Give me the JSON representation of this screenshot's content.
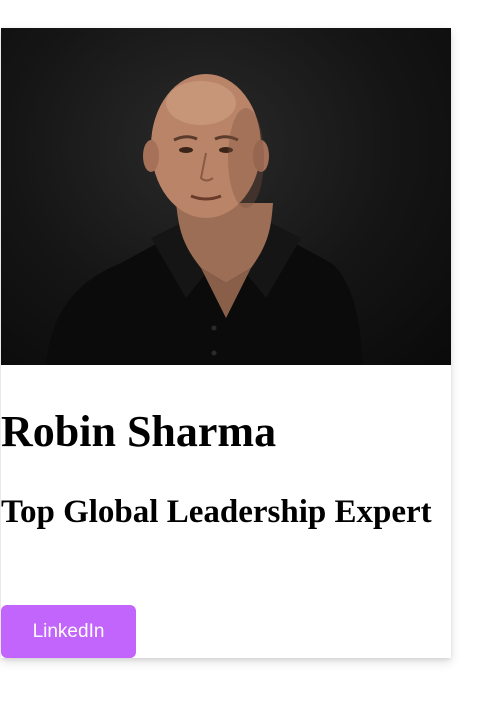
{
  "profile": {
    "photo_alt": "Robin Sharma",
    "name": "Robin Sharma",
    "title": "Top Global Leadership Expert",
    "button_label": "LinkedIn"
  },
  "colors": {
    "button_bg": "#c265fc",
    "button_text": "#ffffff",
    "card_bg": "#ffffff",
    "photo_bg": "#151515"
  }
}
